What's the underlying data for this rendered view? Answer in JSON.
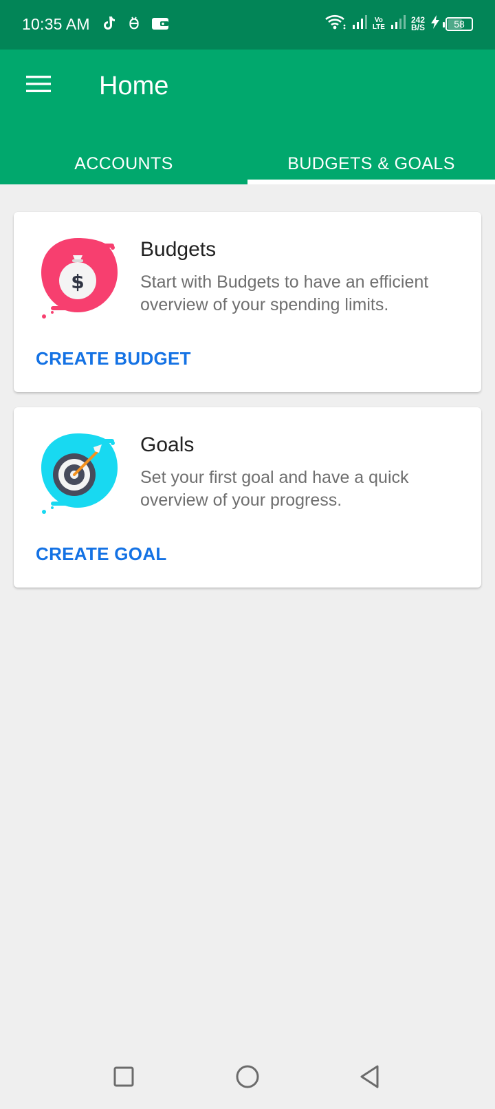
{
  "status_bar": {
    "time": "10:35 AM",
    "network_type": "Vo\nLTE",
    "speed": "242\nB/S",
    "battery_level": "58",
    "left_icons": [
      "tiktok-icon",
      "bug-icon",
      "wallet-icon"
    ],
    "right_icons": [
      "wifi-icon",
      "signal-icon",
      "volte-icon",
      "signal-icon",
      "charging-icon",
      "battery-icon"
    ]
  },
  "app_bar": {
    "title": "Home",
    "menu_icon": "hamburger-menu-icon",
    "background_color": "#01a86d",
    "status_color": "#028557"
  },
  "tabs": [
    {
      "label": "ACCOUNTS",
      "selected": false
    },
    {
      "label": "BUDGETS & GOALS",
      "selected": true
    }
  ],
  "cards": {
    "budgets": {
      "title": "Budgets",
      "description": "Start with Budgets to have an efficient overview of your spending limits.",
      "action": "CREATE BUDGET",
      "icon": "money-bag-icon",
      "accent_color": "#f73f6f"
    },
    "goals": {
      "title": "Goals",
      "description": "Set your first goal and have a quick overview of your progress.",
      "action": "CREATE GOAL",
      "icon": "target-icon",
      "accent_color": "#18d9f1"
    }
  },
  "nav_bar": {
    "buttons": [
      "recent-apps-icon",
      "home-icon",
      "back-icon"
    ]
  },
  "colors": {
    "accent": "#01a86d",
    "link": "#1472e4",
    "background": "#efefef"
  }
}
